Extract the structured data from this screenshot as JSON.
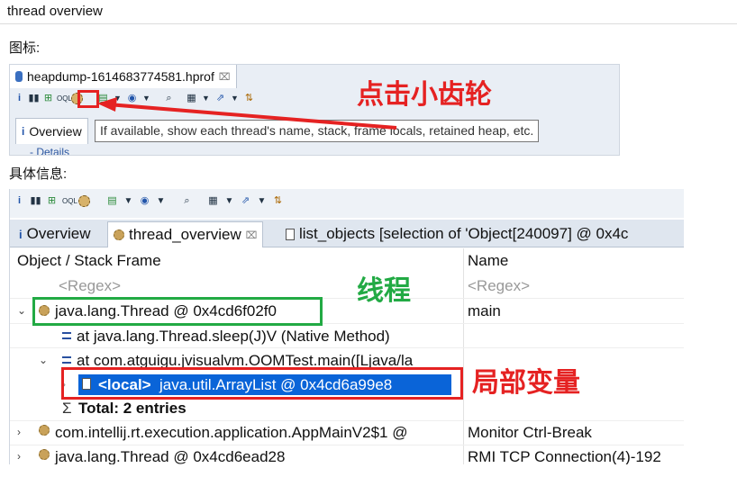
{
  "window_title": "thread overview",
  "section_icon": "图标:",
  "section_detail": "具体信息:",
  "shot1": {
    "file_tab": "heapdump-1614683774581.hprof",
    "file_tab_close": "⌧",
    "overview_tab": "Overview",
    "tooltip": "If available, show each thread's name, stack, frame locals, retained heap, etc.",
    "details": "- Details"
  },
  "annotations": {
    "click_gear": "点击小齿轮",
    "thread": "线程",
    "local_var": "局部变量",
    "arrow_color": "#e52222",
    "thread_box_color": "#22aa44"
  },
  "shot2": {
    "tabs": [
      {
        "label": "Overview",
        "icon": "info-icon"
      },
      {
        "label": "thread_overview",
        "icon": "gear-icon",
        "close": "⌧"
      },
      {
        "label": "list_objects  [selection of 'Object[240097] @ 0x4c",
        "icon": "list-icon"
      }
    ],
    "columns": [
      "Object / Stack Frame",
      "Name"
    ],
    "regex": "<Regex>",
    "rows": [
      {
        "twisty": "⌄",
        "text": "java.lang.Thread @ 0x4cd6f02f0",
        "name": "main"
      },
      {
        "twisty": "",
        "text": "at java.lang.Thread.sleep(J)V (Native Method)",
        "name": ""
      },
      {
        "twisty": "⌄",
        "text": "at com.atguigu.jvisualvm.OOMTest.main([Ljava/la",
        "name": ""
      },
      {
        "twisty": "›",
        "local": "<local>",
        "text": " java.util.ArrayList @ 0x4cd6a99e8",
        "name": ""
      },
      {
        "twisty": "",
        "sigma": "Σ",
        "text": "Total: 2 entries",
        "name": ""
      },
      {
        "twisty": "›",
        "text": "com.intellij.rt.execution.application.AppMainV2$1 @",
        "name": "Monitor Ctrl-Break"
      },
      {
        "twisty": "›",
        "text": "java.lang.Thread @ 0x4cd6ead28",
        "name": "RMI TCP Connection(4)-192"
      }
    ]
  }
}
